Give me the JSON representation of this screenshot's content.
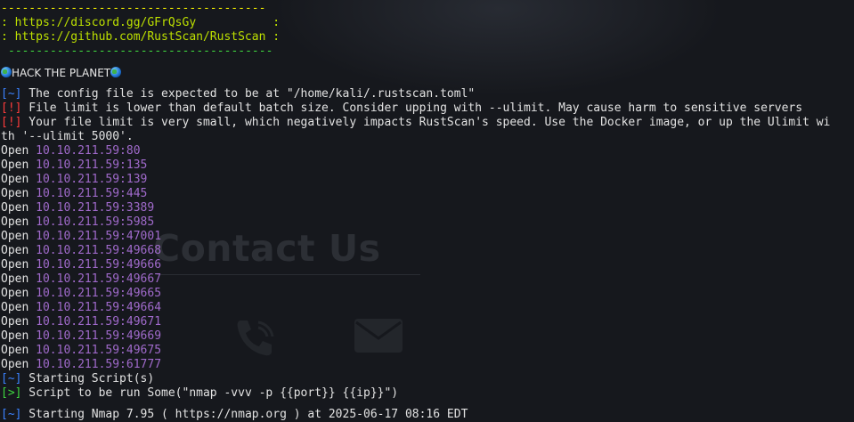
{
  "banner": {
    "dash_top": "--------------------------------------",
    "discord": ": https://discord.gg/GFrQsGy           :",
    "github": ": https://github.com/RustScan/RustScan :",
    "dash_bottom": "--------------------------------------",
    "tagline": "HACK THE PLANET"
  },
  "messages": [
    {
      "tag": "[~]",
      "text": " The config file is expected to be at \"/home/kali/.rustscan.toml\""
    },
    {
      "tag": "[!]",
      "text": " File limit is lower than default batch size. Consider upping with --ulimit. May cause harm to sensitive servers"
    },
    {
      "tag": "[!]",
      "text": " Your file limit is very small, which negatively impacts RustScan's speed. Use the Docker image, or up the Ulimit wi"
    },
    {
      "tag": "",
      "text": "th '--ulimit 5000'."
    }
  ],
  "open_label": "Open",
  "open_ports": [
    "10.10.211.59:80",
    "10.10.211.59:135",
    "10.10.211.59:139",
    "10.10.211.59:445",
    "10.10.211.59:3389",
    "10.10.211.59:5985",
    "10.10.211.59:47001",
    "10.10.211.59:49668",
    "10.10.211.59:49666",
    "10.10.211.59:49667",
    "10.10.211.59:49665",
    "10.10.211.59:49664",
    "10.10.211.59:49671",
    "10.10.211.59:49669",
    "10.10.211.59:49675",
    "10.10.211.59:61777"
  ],
  "script": {
    "starting_tag": "[~]",
    "starting_text": " Starting Script(s)",
    "run_tag": "[>]",
    "run_text": " Script to be run Some(\"nmap -vvv -p {{port}} {{ip}}\")"
  },
  "nmap": {
    "tag": "[~]",
    "text": " Starting Nmap 7.95 ( https://nmap.org ) at 2025-06-17 08:16 EDT"
  },
  "background": {
    "contact_title": "Contact Us"
  },
  "colors": {
    "terminal_bg": "#16181d",
    "banner_yellow": "#e7e300",
    "link_green": "#3fd73f",
    "info_blue": "#3b82ff",
    "warn_red": "#ff3b3b",
    "port_purple": "#a06acb"
  },
  "icons": {
    "globe": "globe-icon",
    "phone": "phone-icon",
    "mail": "mail-icon"
  }
}
